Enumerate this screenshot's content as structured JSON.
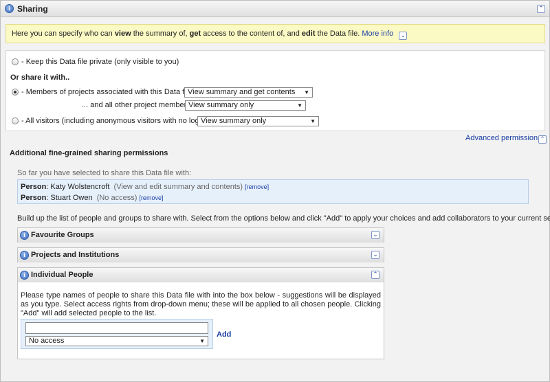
{
  "panel": {
    "title": "Sharing",
    "info_icon": "i",
    "collapse_icon": "double-chevron-up"
  },
  "notice": {
    "part1": "Here you can specify who can ",
    "view": "view",
    "part2": " the summary of, ",
    "get": "get",
    "part3": " access to the content of, and ",
    "edit": "edit",
    "part4": " the Data file. ",
    "more_info": "More info",
    "more_icon": "double-chevron-down"
  },
  "sharing": {
    "private_label": "- Keep this Data file private (only visible to you)",
    "share_heading": "Or share it with..",
    "members_label": "- Members of projects associated with this Data file:",
    "members_value": "View summary and get contents",
    "others_label": "... and all other project members:",
    "others_value": "View summary only",
    "visitors_label": "- All visitors (including anonymous visitors with no login):",
    "visitors_value": "View summary only",
    "advanced_link": "Advanced permissions"
  },
  "fine_grained": {
    "heading": "Additional fine-grained sharing permissions",
    "so_far": "So far you have selected to share this Data file with:",
    "entries": [
      {
        "kind": "Person",
        "sep": ": ",
        "name": "Katy Wolstencroft",
        "access": "(View and edit summary and contents)",
        "remove": "[remove]"
      },
      {
        "kind": "Person",
        "sep": ": ",
        "name": "Stuart Owen",
        "access": "(No access)",
        "remove": "[remove]"
      }
    ],
    "build_text": "Build up the list of people and groups to share with. Select from the options below and click \"Add\" to apply your choices and add collaborators to your current selection:"
  },
  "subpanels": {
    "favourite": {
      "title": "Favourite Groups"
    },
    "projects": {
      "title": "Projects and Institutions"
    },
    "individual": {
      "title": "Individual People",
      "description": "Please type names of people to share this Data file with into the box below - suggestions will be displayed as you type. Select access rights from drop-down menu; these will be applied to all chosen people. Clicking \"Add\" will add selected people to the list.",
      "input_value": "",
      "access_value": "No access",
      "add_label": "Add"
    }
  },
  "colors": {
    "link": "#1a3fa3",
    "notice_bg": "#fbf9c4",
    "selection_bg": "#e6f0fb"
  }
}
